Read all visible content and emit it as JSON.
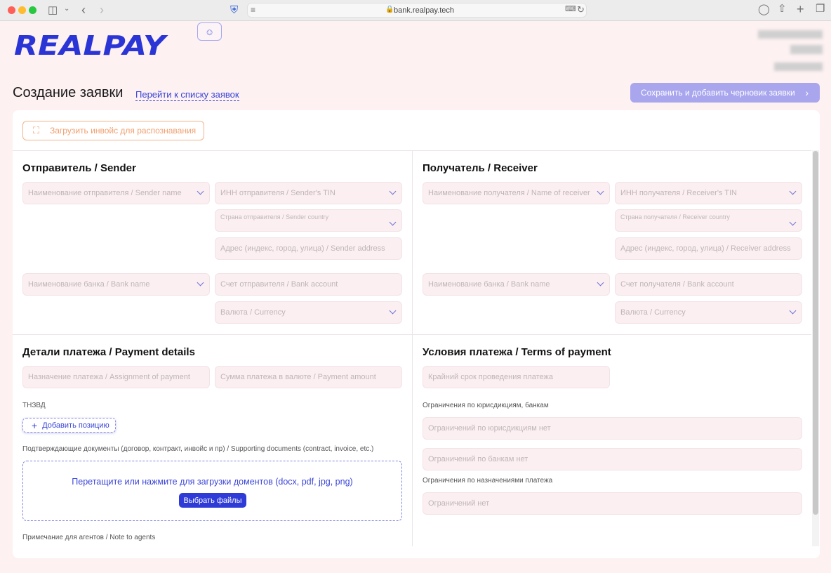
{
  "browser": {
    "url": "bank.realpay.tech"
  },
  "header": {
    "logo_text": "REALPAY"
  },
  "page": {
    "title": "Создание заявки",
    "list_link": "Перейти к списку заявок",
    "save_button": "Сохранить и добавить черновик заявки"
  },
  "invoice_upload": {
    "label": "Загрузить инвойс для распознавания"
  },
  "sender": {
    "title": "Отправитель / Sender",
    "name": "Наименование отправителя / Sender name",
    "tin": "ИНН отправителя / Sender's TIN",
    "country": "Страна отправителя / Sender country",
    "address": "Адрес (индекс, город, улица) / Sender address",
    "bank_name": "Наименование банка / Bank name",
    "account": "Счет отправителя / Bank account",
    "currency": "Валюта / Currency"
  },
  "receiver": {
    "title": "Получатель / Receiver",
    "name": "Наименование получателя / Name of receiver",
    "tin": "ИНН получателя / Receiver's TIN",
    "country": "Страна получателя / Receiver country",
    "address": "Адрес (индекс, город, улица) / Receiver address",
    "bank_name": "Наименование банка / Bank name",
    "account": "Счет получателя / Bank account",
    "currency": "Валюта / Currency"
  },
  "payment_details": {
    "title": "Детали платежа / Payment details",
    "assignment": "Назначение платежа / Assignment of payment",
    "amount": "Сумма платежа в валюте / Payment amount",
    "tnved_label": "ТНЗВД",
    "add_position": "Добавить позицию",
    "documents_label": "Подтверждающие документы (договор, контракт, инвойс и пр) / Supporting documents (contract, invoice, etc.)",
    "drop_text": "Перетащите или нажмите для загрузки доментов (docx, pdf, jpg, png)",
    "choose_files": "Выбрать файлы",
    "note_label": "Примечание для агентов / Note to agents"
  },
  "terms": {
    "title": "Условия платежа / Terms of payment",
    "deadline": "Крайний срок проведения платежа",
    "jurisdiction_label": "Ограничения по юрисдикциям, банкам",
    "jurisdiction_value": "Ограничений по юрисдикциям нет",
    "banks_value": "Ограничений по банкам нет",
    "assignment_label": "Ограничения по назначениями платежа",
    "assignment_value": "Ограничений нет"
  },
  "colors": {
    "accent": "#3a45d8",
    "logo": "#2b35d6",
    "save_button": "#a9a6ee",
    "background": "#fdf1f2",
    "field_background": "#fbeff1",
    "upload_orange": "#f0a070"
  },
  "icons": {
    "profile": "user-icon",
    "chevron": "chevron-down-icon",
    "scan": "scan-icon",
    "plus": "plus-icon"
  }
}
